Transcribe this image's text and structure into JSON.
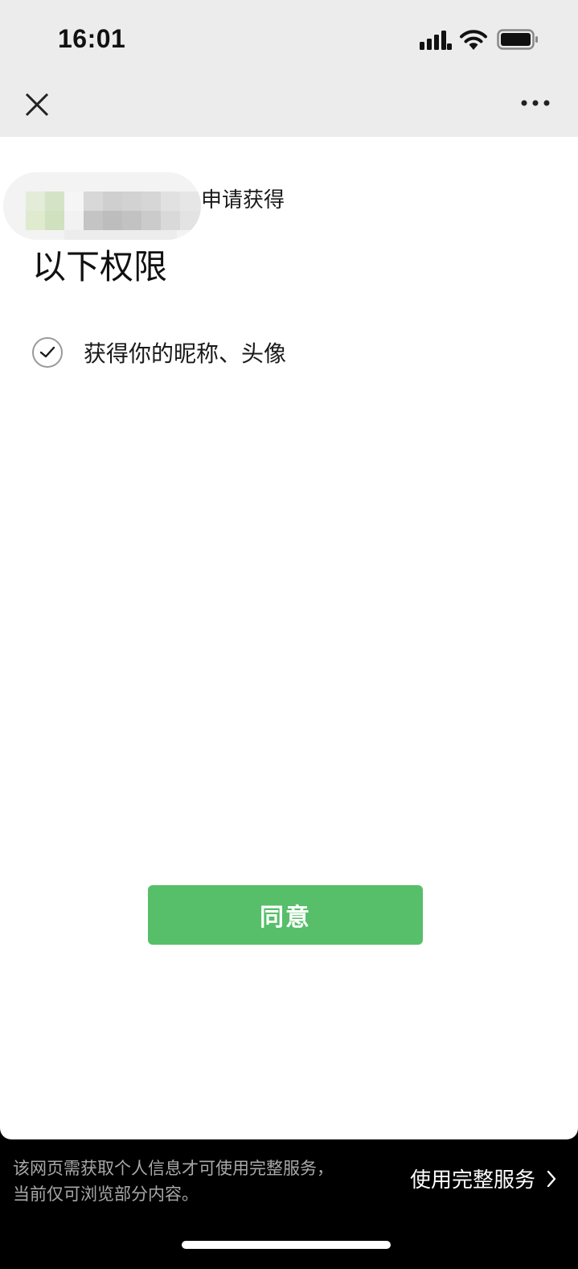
{
  "status_bar": {
    "time": "16:01",
    "icons": [
      "signal-icon",
      "wifi-icon",
      "battery-icon"
    ]
  },
  "nav_bar": {
    "icons": [
      "close-icon",
      "more-icon"
    ]
  },
  "auth": {
    "request_text": "申请获得",
    "title": "以下权限",
    "permission": "获得你的昵称、头像",
    "agree_label": "同意"
  },
  "bottom": {
    "notice_line1": "该网页需获取个人信息才可使用完整服务，",
    "notice_line2": "当前仅可浏览部分内容。",
    "full_service_label": "使用完整服务"
  },
  "colors": {
    "accent_green": "#57be6a",
    "header_bg": "#ececec"
  }
}
